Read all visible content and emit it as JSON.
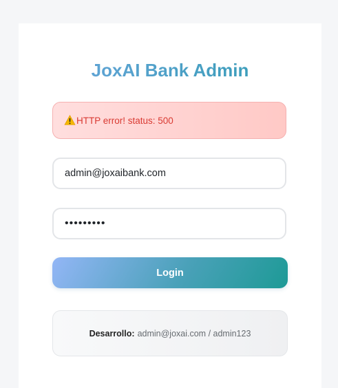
{
  "header": {
    "title": "JoxAI Bank Admin"
  },
  "alert": {
    "icon": "warning-icon",
    "message": "HTTP error! status: 500",
    "color": "#d93a32"
  },
  "form": {
    "email_value": "admin@joxaibank.com",
    "password_value": "secretpw9",
    "login_label": "Login"
  },
  "dev_hint": {
    "label": "Desarrollo:",
    "credentials": "admin@joxai.com / admin123"
  }
}
